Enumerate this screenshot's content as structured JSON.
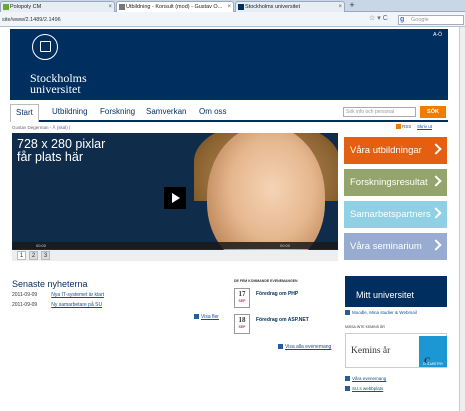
{
  "browser": {
    "tabs": [
      {
        "title": "Polopoly CM"
      },
      {
        "title": "Utbildning - Konsult (mod) - Gustav O..."
      },
      {
        "title": "Stockholms universitet"
      }
    ],
    "url": "site/www/2.1489/2.1496",
    "search_placeholder": "Google"
  },
  "header": {
    "logo_line1": "Stockholms",
    "logo_line2": "universitet",
    "ao_label": "A-Ö"
  },
  "nav": {
    "items": [
      {
        "label": "Start"
      },
      {
        "label": "Utbildning"
      },
      {
        "label": "Forskning"
      },
      {
        "label": "Samverkan"
      },
      {
        "label": "Om oss"
      }
    ],
    "search_placeholder": "Sök info och personal",
    "search_button": "SÖK"
  },
  "crumb": "Gustav Degerman - Å (skal) |",
  "util": {
    "rss": "RSS",
    "print": "Skriv ut"
  },
  "video": {
    "line1": "728 x 280 pixlar",
    "line2": "får plats här",
    "time_start": "00:00",
    "time_end": "00:00",
    "pages": [
      "1",
      "2",
      "3"
    ]
  },
  "promos": [
    {
      "label": "Våra utbildningar",
      "color": "#e35f12"
    },
    {
      "label": "Forskningsresultat",
      "color": "#93a46d"
    },
    {
      "label": "Samarbetspartners",
      "color": "#8fd0e4"
    },
    {
      "label": "Våra seminarium",
      "color": "#98abd1"
    }
  ],
  "news": {
    "heading": "Senaste nyheterna",
    "items": [
      {
        "date": "2011-09-09",
        "title": "Nya IT-systemet är klart"
      },
      {
        "date": "2011-09-09",
        "title": "Ny samarbetare på SU"
      }
    ],
    "more": "Visa fler"
  },
  "events": {
    "heading": "DE FEM KOMMANDE EVENEMANGEN",
    "items": [
      {
        "day": "17",
        "month": "SEP",
        "title": "Föredrag om PHP"
      },
      {
        "day": "18",
        "month": "SEP",
        "title": "Föredrag om ASP.NET"
      }
    ],
    "more": "Visa alla evenemang"
  },
  "minsu": {
    "title": "Mitt universitet",
    "link": "Moodle, Mina studier & Webmail"
  },
  "kemins": {
    "heading": "MISSA INTE KEMINS ÅR",
    "text": "Kemins år",
    "letter": "C",
    "sub": "CHEMISTRY"
  },
  "side_links": [
    "Våra evenemang",
    "SU:s webbplats"
  ]
}
